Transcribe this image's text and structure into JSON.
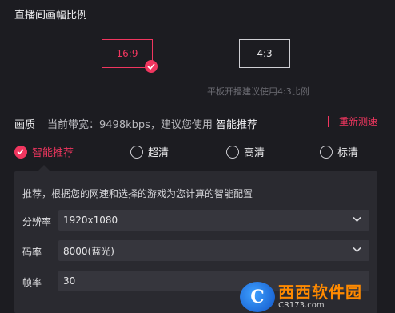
{
  "ratio": {
    "title": "直播间画幅比例",
    "options": [
      "16:9",
      "4:3"
    ],
    "selected": "16:9",
    "hint": "平板开播建议使用4:3比例"
  },
  "quality": {
    "label": "画质",
    "bandwidth_prefix": "当前带宽：9498kbps，建议您使用 ",
    "bandwidth_recommend": "智能推荐",
    "retest": "重新测速",
    "options": [
      "智能推荐",
      "超清",
      "高清",
      "标清"
    ],
    "selected": "智能推荐"
  },
  "panel": {
    "description": "推荐，根据您的网速和选择的游戏为您计算的智能配置",
    "resolution_label": "分辨率",
    "resolution_value": "1920x1080",
    "bitrate_label": "码率",
    "bitrate_value": "8000(蓝光)",
    "framerate_label": "帧率",
    "framerate_value": "30"
  },
  "watermark": {
    "logo_letter": "C",
    "name": "西西软件园",
    "url": "CR173.com"
  },
  "colors": {
    "accent": "#f0365f",
    "background": "#1c1c21",
    "panel": "#2a2a30"
  }
}
